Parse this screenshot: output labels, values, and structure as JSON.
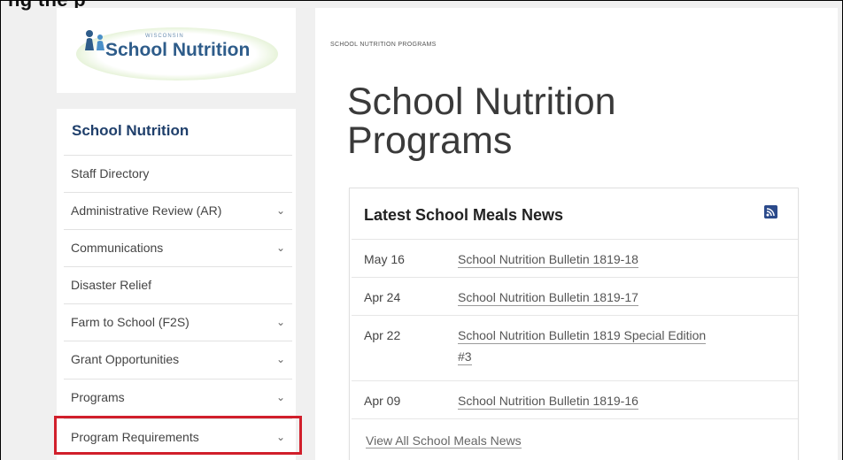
{
  "top_heading_cut": "ng  the  p",
  "logo": {
    "small_text": "WISCONSIN",
    "name": "School Nutrition"
  },
  "sidebar": {
    "title": "School Nutrition",
    "items": [
      {
        "label": "Staff Directory",
        "has_chevron": false
      },
      {
        "label": "Administrative Review (AR)",
        "has_chevron": true
      },
      {
        "label": "Communications",
        "has_chevron": true
      },
      {
        "label": "Disaster Relief",
        "has_chevron": false
      },
      {
        "label": "Farm to School (F2S)",
        "has_chevron": true
      },
      {
        "label": "Grant Opportunities",
        "has_chevron": true
      },
      {
        "label": "Programs",
        "has_chevron": true
      },
      {
        "label": "Program Requirements",
        "has_chevron": true
      }
    ],
    "chevron_glyph": "⌄"
  },
  "main": {
    "breadcrumb": "SCHOOL NUTRITION PROGRAMS",
    "title_line1": "School Nutrition",
    "title_line2": "Programs"
  },
  "news": {
    "title": "Latest School Meals News",
    "items": [
      {
        "date": "May 16",
        "title": "School Nutrition Bulletin 1819-18"
      },
      {
        "date": "Apr 24",
        "title": "School Nutrition Bulletin 1819-17"
      },
      {
        "date": "Apr 22",
        "title_line1": "School Nutrition Bulletin 1819 Special Edition",
        "title_line2": "#3"
      },
      {
        "date": "Apr 09",
        "title": "School Nutrition Bulletin 1819-16"
      }
    ],
    "view_all": "View All School Meals News"
  },
  "colors": {
    "highlight": "#d11f2b",
    "sidebar_title": "#1f3f6b",
    "logo_text": "#2e5c8a",
    "rss": "#2b4a8b"
  },
  "icons": {
    "rss": "rss-icon",
    "chevron": "chevron-down-icon",
    "logo": "family-figures-icon"
  }
}
